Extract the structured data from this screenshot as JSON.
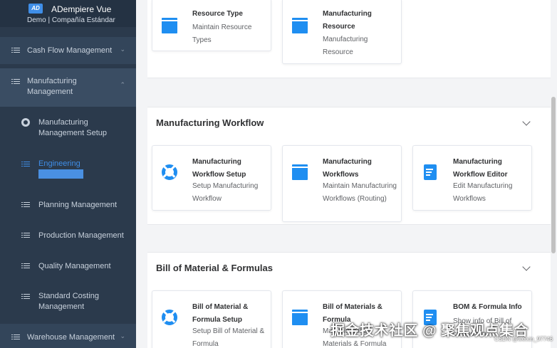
{
  "app": {
    "logo_text": "AD",
    "title": "ADempiere Vue",
    "subtitle": "Demo | Compañía Estándar"
  },
  "sidebar": {
    "items": [
      {
        "label": "Cash Flow Management",
        "icon": "list-icon"
      },
      {
        "label": "Manufacturing Management",
        "icon": "list-icon"
      },
      {
        "label": "Manufacturing Management Setup",
        "icon": "gear-icon"
      },
      {
        "label": "Engineering",
        "icon": "list-icon",
        "active": true
      },
      {
        "label": "Planning Management",
        "icon": "list-icon"
      },
      {
        "label": "Production Management",
        "icon": "list-icon"
      },
      {
        "label": "Quality Management",
        "icon": "list-icon"
      },
      {
        "label": "Standard Costing Management",
        "icon": "list-icon"
      },
      {
        "label": "Warehouse Management",
        "icon": "list-icon"
      }
    ]
  },
  "sections": [
    {
      "title": "",
      "cards": [
        {
          "title": "Resource Type",
          "description": "Maintain Resource Types",
          "icon": "folder-icon"
        },
        {
          "title": "Manufacturing Resource",
          "description": "Manufacturing Resource",
          "icon": "folder-icon"
        }
      ]
    },
    {
      "title": "Manufacturing Workflow",
      "cards": [
        {
          "title": "Manufacturing Workflow Setup",
          "description": "Setup Manufacturing Workflow",
          "icon": "ring-icon"
        },
        {
          "title": "Manufacturing Workflows",
          "description": "Maintain Manufacturing Workflows (Routing)",
          "icon": "folder-icon"
        },
        {
          "title": "Manufacturing Workflow Editor",
          "description": "Edit Manufacturing Workflows",
          "icon": "doc-icon"
        }
      ]
    },
    {
      "title": "Bill of Material & Formulas",
      "cards": [
        {
          "title": "Bill of Material & Formula Setup",
          "description": "Setup Bill of Material & Formula",
          "icon": "ring-icon"
        },
        {
          "title": "Bill of Materials & Formula",
          "description": "Maintain Bill of Materials & Formula",
          "icon": "folder-icon"
        },
        {
          "title": "BOM & Formula Info",
          "description": "Show info of Bill of component",
          "icon": "doc-icon"
        }
      ]
    }
  ],
  "watermark": {
    "text": "掘金技术社区 @ 聚焦观点集合",
    "small": "CSDN @weixin_97746"
  },
  "colors": {
    "sidebar_bg": "#2b3a4c",
    "accent": "#1f8ef1",
    "active_text": "#3f8ee8"
  }
}
